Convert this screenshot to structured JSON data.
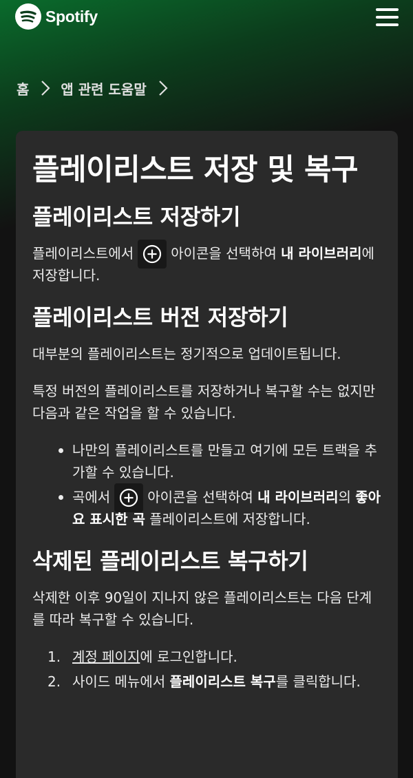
{
  "header": {
    "brand": "Spotify",
    "icons": {
      "logo": "spotify-logo-icon",
      "menu": "hamburger-menu-icon"
    }
  },
  "breadcrumb": [
    "홈",
    "앱 관련 도움말"
  ],
  "article": {
    "title": "플레이리스트 저장 및 복구",
    "sections": [
      {
        "heading": "플레이리스트 저장하기",
        "p1_pre": "플레이리스트에서",
        "p1_mid": "아이콘을 선택하여",
        "p1_bold": "내 라이브러리",
        "p1_post": "에 저장합니다."
      },
      {
        "heading": "플레이리스트 버전 저장하기",
        "p1": "대부분의 플레이리스트는 정기적으로 업데이트됩니다.",
        "p2": "특정 버전의 플레이리스트를 저장하거나 복구할 수는 없지만 다음과 같은 작업을 할 수 있습니다.",
        "bullet1": "나만의 플레이리스트를 만들고 여기에 모든 트랙을 추가할 수 있습니다.",
        "bullet2_pre": "곡에서",
        "bullet2_mid": "아이콘을 선택하여",
        "bullet2_bold1": "내 라이브러리",
        "bullet2_mid2": "의",
        "bullet2_bold2": "좋아요 표시한 곡",
        "bullet2_post": "플레이리스트에 저장합니다."
      },
      {
        "heading": "삭제된 플레이리스트 복구하기",
        "p1": "삭제한 이후 90일이 지나지 않은 플레이리스트는 다음 단계를 따라 복구할 수 있습니다.",
        "steps": [
          {
            "num": "1.",
            "link": "계정 페이지",
            "post": "에 로그인합니다."
          },
          {
            "num": "2.",
            "pre": "사이드 메뉴에서",
            "bold": "플레이리스트 복구",
            "post": "를 클릭합니다."
          }
        ]
      }
    ],
    "icon_add": "plus-circle-icon"
  },
  "colors": {
    "background": "#121212",
    "card": "#2a2a2a",
    "accent_gradient": "#0a6b2c",
    "icon_chip": "#181818"
  }
}
